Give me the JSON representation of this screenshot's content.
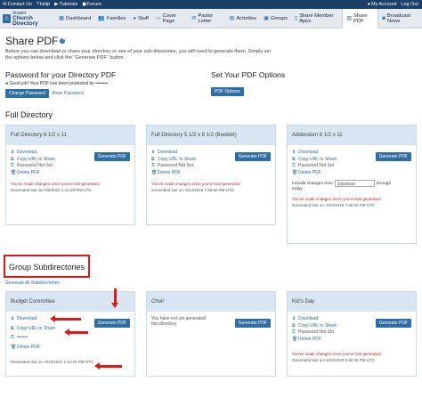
{
  "topbar": {
    "left": [
      "Contact Us",
      "Help",
      "Tutorials",
      "Forum"
    ],
    "right": [
      "My Account",
      "Log Out"
    ]
  },
  "logo": {
    "line1": "Instant",
    "line2": "Church Directory"
  },
  "nav": [
    "Dashboard",
    "Families",
    "Staff",
    "Cover Page",
    "Pastor Letter",
    "Activities",
    "Groups",
    "Share Member Apps",
    "Share PDF",
    "Broadcast News"
  ],
  "page": {
    "title": "Share PDF",
    "intro": "Before you can download or share your directory or one of your sub-directories, you will need to generate them. Simply set the options below and click the \"Generate PDF\" button."
  },
  "password": {
    "heading": "Password for your Directory PDF",
    "status": "Good job! Your PDF has been protected by",
    "mask": "••••••••",
    "change_btn": "Change Password",
    "show_link": "Show Password"
  },
  "options": {
    "heading": "Set Your PDF Options",
    "btn": "PDF Options"
  },
  "full_directory": {
    "heading": "Full Directory",
    "cards": [
      {
        "title": "Full Directory 8 1/2 x 11",
        "download": "Download",
        "copy": "Copy URL to Share",
        "password": "Password Not Set",
        "delete": "Delete PDF",
        "generate": "Generate PDF",
        "warning": "You've made changes since you've last generated",
        "generated": "Generated last on: 6/8/2021 1:14:25 PM UTC"
      },
      {
        "title": "Full Directory 5 1/2 x 8 1/2 (Booklet)",
        "download": "Download",
        "copy": "Copy URL to Share",
        "password": "Password Not Set",
        "delete": "Delete PDF",
        "generate": "Generate PDF",
        "warning": "You've made changes since you've last generated",
        "generated": "Generated last on: 6/14/2019 7:46:52 PM UTC"
      },
      {
        "title": "Addendum 8 1/2 x 11",
        "download": "Download",
        "copy": "Copy URL to Share",
        "password": "Password Not Set",
        "delete": "Delete PDF",
        "generate": "Generate PDF",
        "changes_from": "Include changes from",
        "date": "4/20/2019",
        "through": "through",
        "today": "today",
        "warning": "You've made changes since you've last generated",
        "generated": "Generated last on: 6/14/2019 7:46:52 PM UTC"
      }
    ]
  },
  "group_subdirectories": {
    "heading": "Group Subdirectories",
    "generate_all": "Generate All Subdirectories",
    "cards": [
      {
        "title": "Budget Committee",
        "download": "Download",
        "copy": "Copy URL to Share",
        "password_mask": "•••••••",
        "delete": "Delete PDF",
        "generate": "Generate PDF",
        "generated": "Generated last on: 8/12/2021 1:14:20 PM UTC"
      },
      {
        "title": "Choir",
        "not_generated": "You have not yet generated this directory",
        "generate": "Generate PDF"
      },
      {
        "title": "Kid's Day",
        "download": "Download",
        "copy": "Copy URL to Share",
        "password": "Password Not Set",
        "delete": "Delete PDF",
        "generate": "Generate PDF",
        "warning": "You've made changes since you've last generated",
        "generated": "Generated last on: 6/10/2020 5:18:35 PM UTC"
      }
    ]
  },
  "colors": {
    "primary": "#2f6ea5",
    "navy": "#1b3f66",
    "annotation": "#e01a1a",
    "warning": "#c42020"
  }
}
